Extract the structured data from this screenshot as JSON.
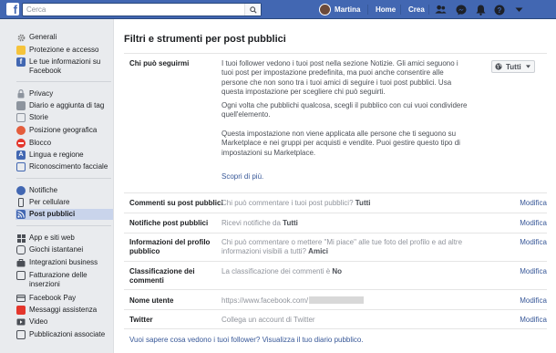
{
  "topbar": {
    "search_placeholder": "Cerca",
    "user_name": "Martina",
    "home": "Home",
    "create": "Crea"
  },
  "sidebar": {
    "group1": [
      {
        "label": "Generali",
        "icon": "gear-icon",
        "color": "#7f7f7f"
      },
      {
        "label": "Protezione e accesso",
        "icon": "shield-icon",
        "color": "#f5c33b"
      },
      {
        "label": "Le tue informazioni su Facebook",
        "icon": "facebook-icon",
        "color": "#4267b2"
      }
    ],
    "group2": [
      {
        "label": "Privacy",
        "icon": "lock-icon",
        "color": "#8d949e"
      },
      {
        "label": "Diario e aggiunta di tag",
        "icon": "timeline-icon",
        "color": "#8d949e"
      },
      {
        "label": "Storie",
        "icon": "book-icon",
        "color": "#8d949e"
      },
      {
        "label": "Posizione geografica",
        "icon": "location-icon",
        "color": "#e45d3c"
      },
      {
        "label": "Blocco",
        "icon": "block-icon",
        "color": "#e4362c"
      },
      {
        "label": "Lingua e regione",
        "icon": "language-icon",
        "color": "#4267b2"
      },
      {
        "label": "Riconoscimento facciale",
        "icon": "face-icon",
        "color": "#4267b2"
      }
    ],
    "group3": [
      {
        "label": "Notifiche",
        "icon": "globe-icon",
        "color": "#4267b2"
      },
      {
        "label": "Per cellulare",
        "icon": "mobile-icon",
        "color": "#4b4f56"
      },
      {
        "label": "Post pubblici",
        "icon": "rss-icon",
        "color": "#4267b2",
        "active": true
      }
    ],
    "group4": [
      {
        "label": "App e siti web",
        "icon": "apps-icon",
        "color": "#4b4f56"
      },
      {
        "label": "Giochi istantanei",
        "icon": "game-icon",
        "color": "#4b4f56"
      },
      {
        "label": "Integrazioni business",
        "icon": "briefcase-icon",
        "color": "#4b4f56"
      },
      {
        "label": "Fatturazione delle inserzioni",
        "icon": "billing-icon",
        "color": "#4b4f56"
      },
      {
        "label": "Facebook Pay",
        "icon": "card-icon",
        "color": "#4b4f56"
      },
      {
        "label": "Messaggi assistenza",
        "icon": "support-icon",
        "color": "#e4362c"
      },
      {
        "label": "Video",
        "icon": "video-icon",
        "color": "#4b4f56"
      },
      {
        "label": "Pubblicazioni associate",
        "icon": "linked-icon",
        "color": "#4b4f56"
      }
    ]
  },
  "main": {
    "title": "Filtri e strumenti per post pubblici",
    "followers": {
      "label": "Chi può seguirmi",
      "para1": "I tuoi follower vedono i tuoi post nella sezione Notizie. Gli amici seguono i tuoi post per impostazione predefinita, ma puoi anche consentire alle persone che non sono tra i tuoi amici di seguire i tuoi post pubblici. Usa questa impostazione per scegliere chi può seguirti.",
      "para2": "Ogni volta che pubblichi qualcosa, scegli il pubblico con cui vuoi condividere quell'elemento.",
      "para3": "Questa impostazione non viene applicata alle persone che ti seguono su Marketplace e nei gruppi per acquisti e vendite. Puoi gestire questo tipo di impostazioni su Marketplace.",
      "learn_more": "Scopri di più.",
      "dropdown_value": "Tutti"
    },
    "rows": [
      {
        "label": "Commenti su post pubblici",
        "text": "Chi può commentare i tuoi post pubblici?",
        "value": "Tutti",
        "edit": "Modifica"
      },
      {
        "label": "Notifiche post pubblici",
        "text": "Ricevi notifiche da",
        "value": "Tutti",
        "edit": "Modifica"
      },
      {
        "label": "Informazioni del profilo pubblico",
        "text": "Chi può commentare o mettere \"Mi piace\" alle tue foto del profilo e ad altre informazioni visibili a tutti?",
        "value": "Amici",
        "edit": "Modifica"
      },
      {
        "label": "Classificazione dei commenti",
        "text": "La classificazione dei commenti è",
        "value": "No",
        "edit": "Modifica"
      },
      {
        "label": "Nome utente",
        "text": "https://www.facebook.com/",
        "value": "",
        "edit": "Modifica"
      },
      {
        "label": "Twitter",
        "text": "Collega un account di Twitter",
        "value": "",
        "edit": "Modifica"
      }
    ],
    "footer_link": "Vuoi sapere cosa vedono i tuoi follower? Visualizza il tuo diario pubblico."
  }
}
